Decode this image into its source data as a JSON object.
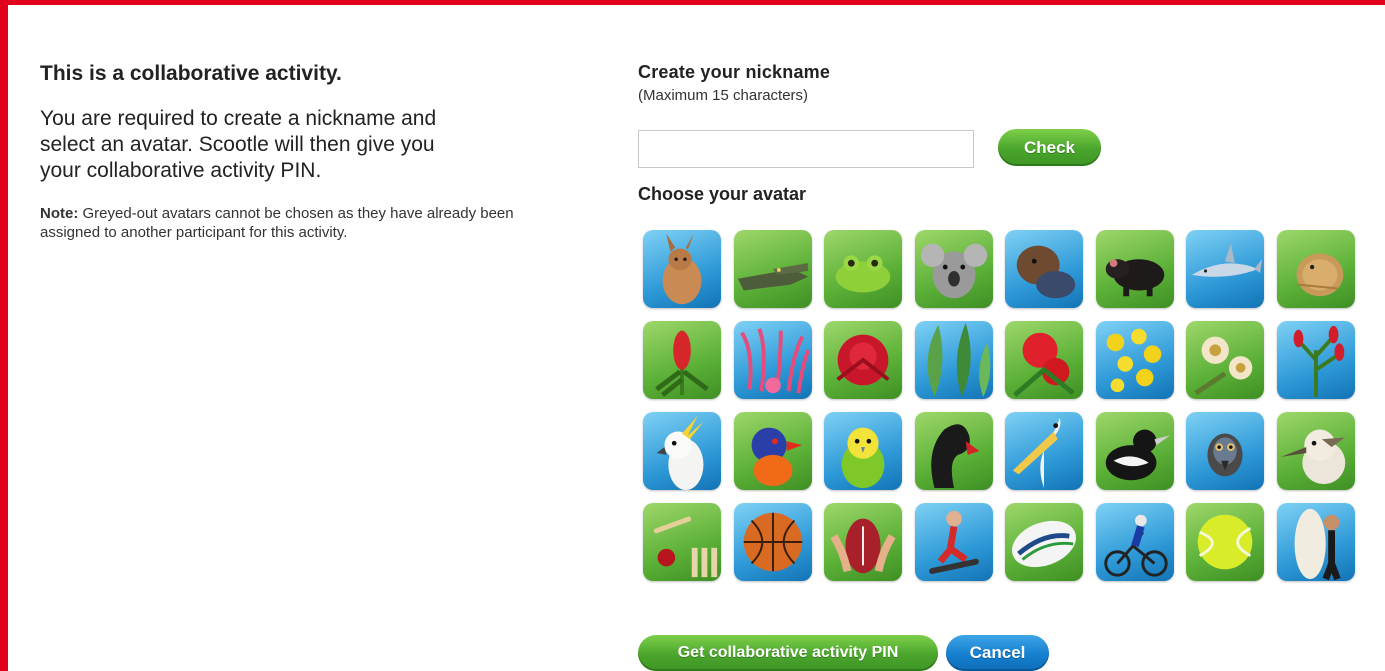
{
  "left": {
    "heading": "This is a collaborative activity.",
    "intro": "You are required to create a nickname and select an avatar. Scootle will then give you your collaborative activity PIN.",
    "note_label": "Note:",
    "note_text": " Greyed-out avatars cannot be chosen as they have already been assigned to another participant for this activity."
  },
  "nickname": {
    "title": "Create your nickname",
    "hint": "(Maximum 15 characters)",
    "value": "",
    "placeholder": "",
    "check_label": "Check"
  },
  "avatar": {
    "title": "Choose your avatar",
    "tiles": [
      [
        "kangaroo-icon",
        "b"
      ],
      [
        "crocodile-icon",
        "g"
      ],
      [
        "frog-icon",
        "g"
      ],
      [
        "koala-icon",
        "g"
      ],
      [
        "platypus-icon",
        "b"
      ],
      [
        "tasmanian-devil-icon",
        "g"
      ],
      [
        "shark-icon",
        "b"
      ],
      [
        "lizard-icon",
        "g"
      ],
      [
        "bottlebrush-flower-icon",
        "g"
      ],
      [
        "grevillea-flower-icon",
        "b"
      ],
      [
        "waratah-flower-icon",
        "g"
      ],
      [
        "eucalyptus-leaves-icon",
        "b"
      ],
      [
        "red-gum-blossom-icon",
        "g"
      ],
      [
        "wattle-flower-icon",
        "b"
      ],
      [
        "gum-blossom-icon",
        "g"
      ],
      [
        "kangaroo-paw-flower-icon",
        "b"
      ],
      [
        "cockatoo-icon",
        "b"
      ],
      [
        "lorikeet-icon",
        "g"
      ],
      [
        "budgerigar-icon",
        "b"
      ],
      [
        "black-swan-icon",
        "g"
      ],
      [
        "pelican-icon",
        "b"
      ],
      [
        "magpie-icon",
        "g"
      ],
      [
        "emu-icon",
        "b"
      ],
      [
        "kookaburra-icon",
        "g"
      ],
      [
        "cricket-icon",
        "g"
      ],
      [
        "basketball-icon",
        "b"
      ],
      [
        "football-icon",
        "g"
      ],
      [
        "skateboard-icon",
        "b"
      ],
      [
        "rugby-ball-icon",
        "g"
      ],
      [
        "cyclist-icon",
        "b"
      ],
      [
        "tennis-ball-icon",
        "g"
      ],
      [
        "surfboard-icon",
        "b"
      ]
    ]
  },
  "actions": {
    "pin_label": "Get collaborative activity PIN",
    "cancel_label": "Cancel"
  },
  "colors": {
    "frame": "#e0001b",
    "green_button": "#4aa52c",
    "blue_button": "#157fd0"
  }
}
